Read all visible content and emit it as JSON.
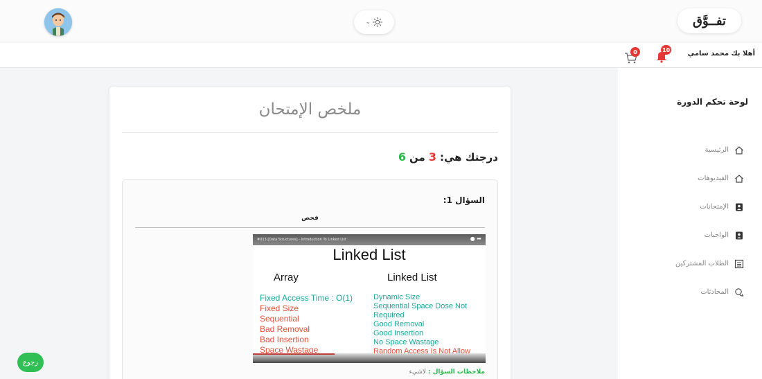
{
  "header": {
    "brand": "تفــوَّق",
    "theme_toggle_icon": "sun-icon"
  },
  "strip": {
    "welcome": "أهلا بك محمد سامي",
    "notifications_count": "10",
    "cart_count": "0"
  },
  "sidebar": {
    "title": "لوحة تحكم الدورة",
    "items": [
      {
        "label": "الرئيسية",
        "icon": "home-icon"
      },
      {
        "label": "الفيديوهات",
        "icon": "home-icon"
      },
      {
        "label": "الإمتحانات",
        "icon": "id-card-icon"
      },
      {
        "label": "الواجبات",
        "icon": "id-card-icon"
      },
      {
        "label": "الطلاب المشتركين",
        "icon": "list-icon"
      },
      {
        "label": "المحادثات",
        "icon": "chat-icon"
      }
    ]
  },
  "exam": {
    "title": "ملخص الإمتحان",
    "score_prefix": "درجتك هي:",
    "score_got": "3",
    "score_sep": "من",
    "score_total": "6",
    "question_label": "السؤال 1:",
    "question_text": "فحص",
    "note_label": "ملاحظات السؤال :",
    "note_value": "لاشيء"
  },
  "video": {
    "top_title": "#013 [Data Structures] - Introduction To Linked List",
    "heading": "Linked List",
    "left_header": "Array",
    "right_header": "Linked List",
    "left_lines": [
      {
        "text": "Fixed Access Time : O(1)",
        "color": "#1aa99a"
      },
      {
        "text": "Fixed Size",
        "color": "#e0503c"
      },
      {
        "text": "Sequential",
        "color": "#e0503c"
      },
      {
        "text": "Bad Removal",
        "color": "#e0503c"
      },
      {
        "text": "Bad Insertion",
        "color": "#e0503c"
      },
      {
        "text": "Space Wastage",
        "color": "#e0503c"
      }
    ],
    "right_lines": [
      {
        "text": "Dynamic Size",
        "color": "#1aa99a"
      },
      {
        "text": "Sequential Space Dose Not",
        "color": "#1aa99a"
      },
      {
        "text": "Required",
        "color": "#1aa99a"
      },
      {
        "text": "Good Removal",
        "color": "#1aa99a"
      },
      {
        "text": "Good Insertion",
        "color": "#1aa99a"
      },
      {
        "text": "No Space Wastage",
        "color": "#1aa99a"
      },
      {
        "text": "Random Access Is Not Allow",
        "color": "#e0503c"
      }
    ],
    "progress": 0.35
  },
  "back_button": "رجوع",
  "colors": {
    "accent_green": "#2db84c",
    "accent_red": "#e53935"
  }
}
